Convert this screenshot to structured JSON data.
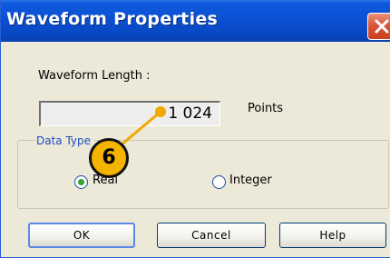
{
  "window": {
    "title": "Waveform Properties",
    "close_icon": "close-icon"
  },
  "waveform_length": {
    "label": "Waveform Length :",
    "value": "1 024",
    "unit": "Points"
  },
  "data_type": {
    "legend": "Data Type",
    "options": [
      {
        "label": "Real",
        "selected": true
      },
      {
        "label": "Integer",
        "selected": false
      }
    ]
  },
  "buttons": {
    "ok": "OK",
    "cancel": "Cancel",
    "help": "Help"
  },
  "callout": {
    "number": "6",
    "color": "#f4b400"
  }
}
